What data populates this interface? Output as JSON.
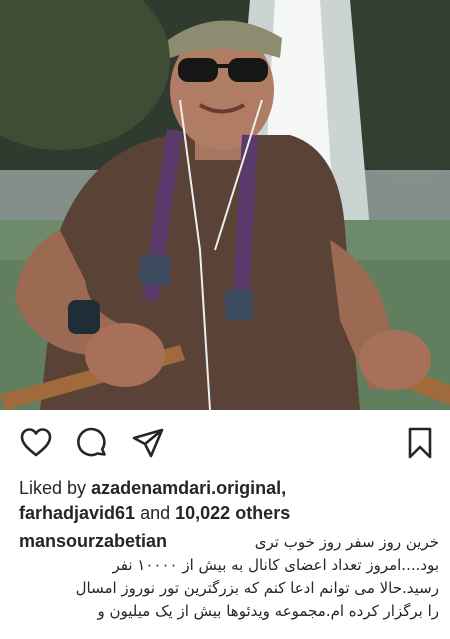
{
  "post": {
    "photo_alt": "Man wearing sunglasses and a flat cap rowing a boat in front of a waterfall",
    "actions": {
      "like": "heart-icon",
      "comment": "comment-bubble-icon",
      "share": "paper-plane-icon",
      "save": "bookmark-icon"
    },
    "likes": {
      "prefix": "Liked by",
      "user1": "azadenamdari.original",
      "comma": ",",
      "user2": "farhadjavid61",
      "and": "and",
      "count": "10,022 others"
    },
    "caption": {
      "username": "mansourzabetian",
      "lines": [
        "خرین روز سفر روز خوب تری",
        "بود....امروز تعداد اعضای کانال به بیش از ۱۰۰۰۰ نفر",
        "رسید.حالا می توانم ادعا کنم که بزرگترین تور نوروز امسال",
        "را برگزار کرده ام.مجموعه ویدئوها بیش از یک میلیون و"
      ]
    }
  },
  "colors": {
    "text": "#262626",
    "background": "#ffffff"
  }
}
